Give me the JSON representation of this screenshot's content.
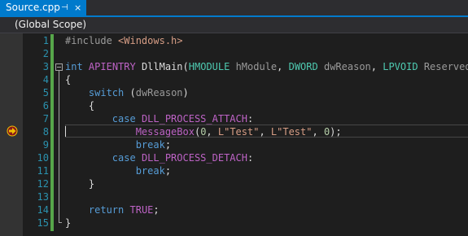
{
  "tab": {
    "title": "Source.cpp",
    "pin_glyph": "⊣",
    "close_glyph": "×"
  },
  "scope": {
    "label": "(Global Scope)"
  },
  "lines": [
    {
      "n": "1"
    },
    {
      "n": "2"
    },
    {
      "n": "3"
    },
    {
      "n": "4"
    },
    {
      "n": "5"
    },
    {
      "n": "6"
    },
    {
      "n": "7"
    },
    {
      "n": "8"
    },
    {
      "n": "9"
    },
    {
      "n": "10"
    },
    {
      "n": "11"
    },
    {
      "n": "12"
    },
    {
      "n": "13"
    },
    {
      "n": "14"
    },
    {
      "n": "15"
    }
  ],
  "code": {
    "l1": {
      "directive": "#include",
      "header": "<Windows.h>"
    },
    "l3": {
      "kw": "int",
      "conv": "APIENTRY",
      "name": "DllMain",
      "p1type": "HMODULE",
      "p1": "hModule",
      "p2type": "DWORD",
      "p2": "dwReason",
      "p3type": "LPVOID",
      "p3": "Reserved"
    },
    "l4": {
      "text": "{"
    },
    "l5": {
      "kw": "switch",
      "arg": "dwReason"
    },
    "l6": {
      "text": "{"
    },
    "l7": {
      "kw": "case",
      "val": "DLL_PROCESS_ATTACH"
    },
    "l8": {
      "fn": "MessageBox",
      "a1": "0",
      "a2": "L\"Test\"",
      "a3": "L\"Test\"",
      "a4": "0"
    },
    "l9": {
      "kw": "break"
    },
    "l10": {
      "kw": "case",
      "val": "DLL_PROCESS_DETACH"
    },
    "l11": {
      "kw": "break"
    },
    "l12": {
      "text": "}"
    },
    "l14": {
      "kw": "return",
      "val": "TRUE"
    },
    "l15": {
      "text": "}"
    }
  },
  "colors": {
    "accent": "#007acc",
    "keyword": "#569cd6",
    "type": "#4ec9b0",
    "macro": "#bd63c5",
    "string": "#d69d85",
    "line_number": "#2b91af",
    "change_bar": "#57a64a",
    "breakpoint_arrow": "#f0c000"
  },
  "icons": {
    "current_statement": "yellow-arrow-breakpoint-icon",
    "collapse": "minus-box-icon"
  }
}
